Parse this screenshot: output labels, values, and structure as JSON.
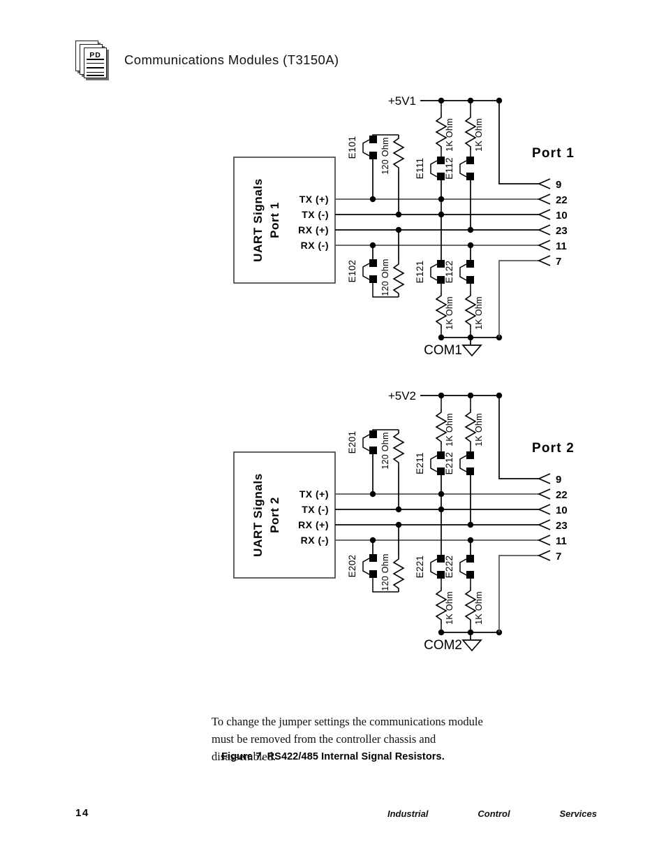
{
  "header": {
    "icon": "pd-document-stack-icon",
    "icon_label": "PD",
    "title": "Communications Modules (T3150A)"
  },
  "figure": {
    "caption": "Figure 7.  RS422/485 Internal Signal Resistors.",
    "diagrams": [
      {
        "id": "port1",
        "box_line1": "UART Signals",
        "box_line2": "Port  1",
        "port_label": "Port  1",
        "rail_label": "+5V1",
        "ground_label": "COM1",
        "signals": [
          "TX  (+)",
          "TX  (-)",
          "RX  (+)",
          "RX  (-)"
        ],
        "pins": [
          "9",
          "22",
          "10",
          "23",
          "11",
          "7"
        ],
        "jumpers_top": [
          "E101",
          "E111",
          "E112"
        ],
        "jumpers_bottom": [
          "E102",
          "E121",
          "E122"
        ],
        "resistor_120_top": "120 Ohm",
        "resistor_120_bottom": "120 Ohm",
        "resistors_1k_top": [
          "1K Ohm",
          "1K Ohm"
        ],
        "resistors_1k_bottom": [
          "1K Ohm",
          "1K Ohm"
        ]
      },
      {
        "id": "port2",
        "box_line1": "UART Signals",
        "box_line2": "Port  2",
        "port_label": "Port  2",
        "rail_label": "+5V2",
        "ground_label": "COM2",
        "signals": [
          "TX  (+)",
          "TX  (-)",
          "RX  (+)",
          "RX  (-)"
        ],
        "pins": [
          "9",
          "22",
          "10",
          "23",
          "11",
          "7"
        ],
        "jumpers_top": [
          "E201",
          "E211",
          "E212"
        ],
        "jumpers_bottom": [
          "E202",
          "E221",
          "E222"
        ],
        "resistor_120_top": "120 Ohm",
        "resistor_120_bottom": "120 Ohm",
        "resistors_1k_top": [
          "1K Ohm",
          "1K Ohm"
        ],
        "resistors_1k_bottom": [
          "1K Ohm",
          "1K Ohm"
        ]
      }
    ]
  },
  "body": {
    "paragraph_line1": "To change the jumper settings the communications module",
    "paragraph_line2": "must be removed from the controller chassis and",
    "paragraph_line3": "disassembled."
  },
  "footer": {
    "page_number": "14",
    "words": [
      "Industrial",
      "Control",
      "Services"
    ]
  },
  "colors": {
    "ink": "#000000",
    "box_stroke": "#3b3b3b",
    "grey_wire": "#555555",
    "page_background": "#ffffff"
  }
}
